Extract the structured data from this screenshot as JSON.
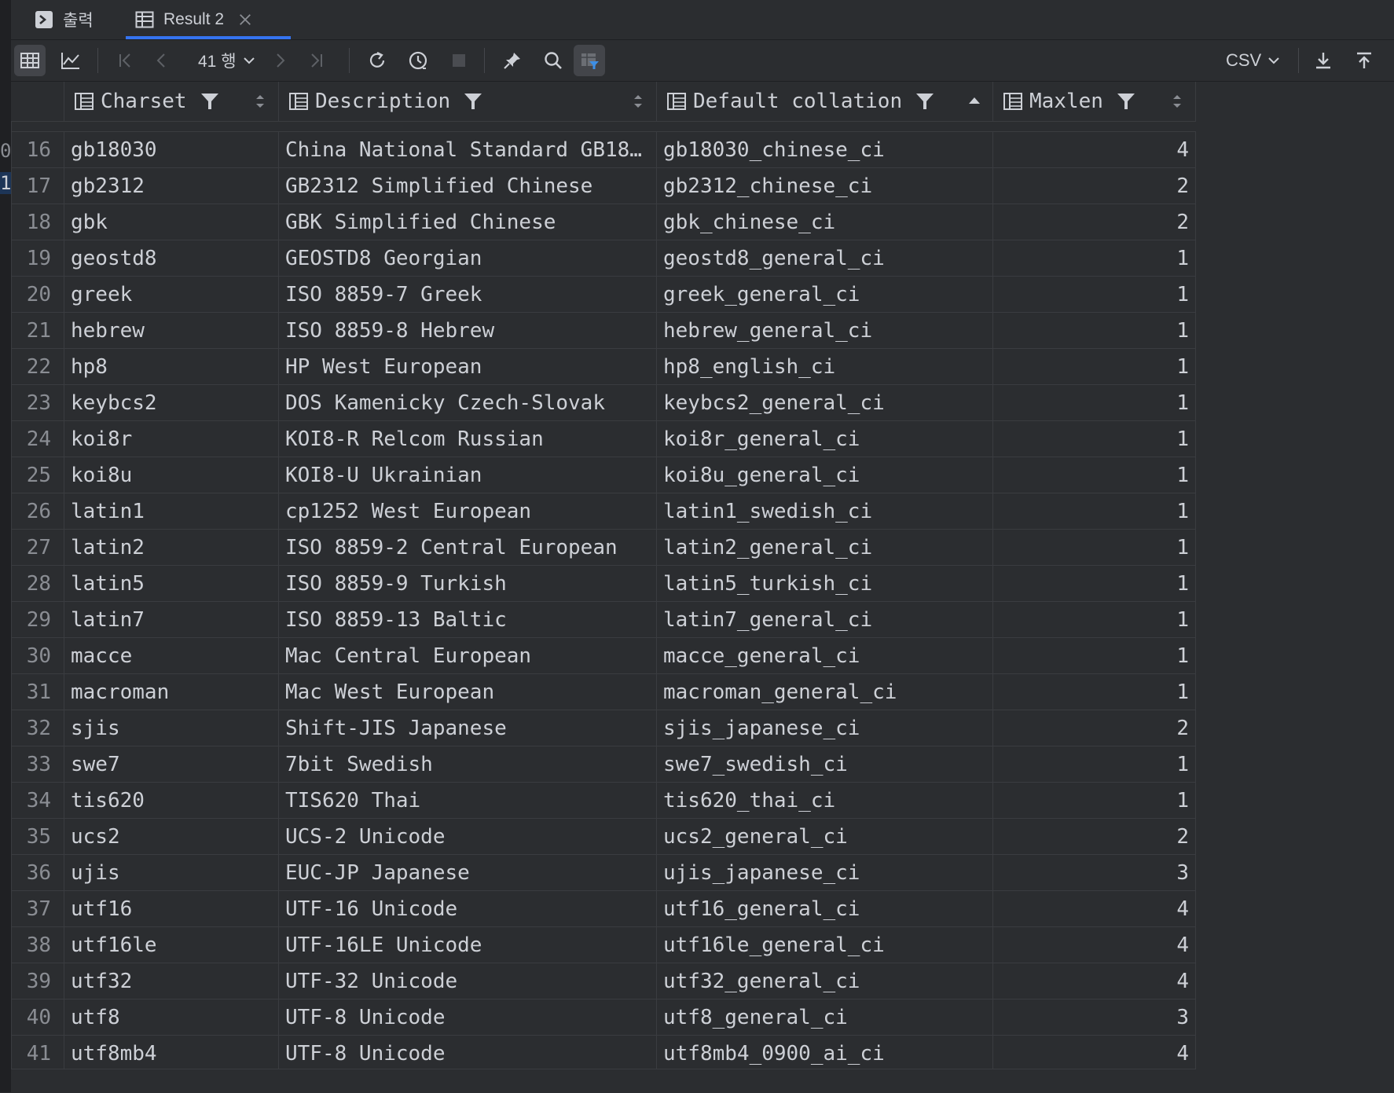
{
  "tabs": [
    {
      "label": "출력",
      "icon": "terminal-icon"
    },
    {
      "label": "Result 2",
      "icon": "table-icon"
    }
  ],
  "toolbar": {
    "rows_label": "41 행",
    "export_format": "CSV"
  },
  "columns": [
    {
      "label": "Charset"
    },
    {
      "label": "Description"
    },
    {
      "label": "Default collation"
    },
    {
      "label": "Maxlen"
    }
  ],
  "gutter": [
    "0",
    "1"
  ],
  "rows": [
    {
      "n": "16",
      "charset": "gb18030",
      "desc": "China National Standard GB18…",
      "coll": "gb18030_chinese_ci",
      "max": "4"
    },
    {
      "n": "17",
      "charset": "gb2312",
      "desc": "GB2312 Simplified Chinese",
      "coll": "gb2312_chinese_ci",
      "max": "2"
    },
    {
      "n": "18",
      "charset": "gbk",
      "desc": "GBK Simplified Chinese",
      "coll": "gbk_chinese_ci",
      "max": "2"
    },
    {
      "n": "19",
      "charset": "geostd8",
      "desc": "GEOSTD8 Georgian",
      "coll": "geostd8_general_ci",
      "max": "1"
    },
    {
      "n": "20",
      "charset": "greek",
      "desc": "ISO 8859-7 Greek",
      "coll": "greek_general_ci",
      "max": "1"
    },
    {
      "n": "21",
      "charset": "hebrew",
      "desc": "ISO 8859-8 Hebrew",
      "coll": "hebrew_general_ci",
      "max": "1"
    },
    {
      "n": "22",
      "charset": "hp8",
      "desc": "HP West European",
      "coll": "hp8_english_ci",
      "max": "1"
    },
    {
      "n": "23",
      "charset": "keybcs2",
      "desc": "DOS Kamenicky Czech-Slovak",
      "coll": "keybcs2_general_ci",
      "max": "1"
    },
    {
      "n": "24",
      "charset": "koi8r",
      "desc": "KOI8-R Relcom Russian",
      "coll": "koi8r_general_ci",
      "max": "1"
    },
    {
      "n": "25",
      "charset": "koi8u",
      "desc": "KOI8-U Ukrainian",
      "coll": "koi8u_general_ci",
      "max": "1"
    },
    {
      "n": "26",
      "charset": "latin1",
      "desc": "cp1252 West European",
      "coll": "latin1_swedish_ci",
      "max": "1"
    },
    {
      "n": "27",
      "charset": "latin2",
      "desc": "ISO 8859-2 Central European",
      "coll": "latin2_general_ci",
      "max": "1"
    },
    {
      "n": "28",
      "charset": "latin5",
      "desc": "ISO 8859-9 Turkish",
      "coll": "latin5_turkish_ci",
      "max": "1"
    },
    {
      "n": "29",
      "charset": "latin7",
      "desc": "ISO 8859-13 Baltic",
      "coll": "latin7_general_ci",
      "max": "1"
    },
    {
      "n": "30",
      "charset": "macce",
      "desc": "Mac Central European",
      "coll": "macce_general_ci",
      "max": "1"
    },
    {
      "n": "31",
      "charset": "macroman",
      "desc": "Mac West European",
      "coll": "macroman_general_ci",
      "max": "1"
    },
    {
      "n": "32",
      "charset": "sjis",
      "desc": "Shift-JIS Japanese",
      "coll": "sjis_japanese_ci",
      "max": "2"
    },
    {
      "n": "33",
      "charset": "swe7",
      "desc": "7bit Swedish",
      "coll": "swe7_swedish_ci",
      "max": "1"
    },
    {
      "n": "34",
      "charset": "tis620",
      "desc": "TIS620 Thai",
      "coll": "tis620_thai_ci",
      "max": "1"
    },
    {
      "n": "35",
      "charset": "ucs2",
      "desc": "UCS-2 Unicode",
      "coll": "ucs2_general_ci",
      "max": "2"
    },
    {
      "n": "36",
      "charset": "ujis",
      "desc": "EUC-JP Japanese",
      "coll": "ujis_japanese_ci",
      "max": "3"
    },
    {
      "n": "37",
      "charset": "utf16",
      "desc": "UTF-16 Unicode",
      "coll": "utf16_general_ci",
      "max": "4"
    },
    {
      "n": "38",
      "charset": "utf16le",
      "desc": "UTF-16LE Unicode",
      "coll": "utf16le_general_ci",
      "max": "4"
    },
    {
      "n": "39",
      "charset": "utf32",
      "desc": "UTF-32 Unicode",
      "coll": "utf32_general_ci",
      "max": "4"
    },
    {
      "n": "40",
      "charset": "utf8",
      "desc": "UTF-8 Unicode",
      "coll": "utf8_general_ci",
      "max": "3"
    },
    {
      "n": "41",
      "charset": "utf8mb4",
      "desc": "UTF-8 Unicode",
      "coll": "utf8mb4_0900_ai_ci",
      "max": "4"
    }
  ]
}
